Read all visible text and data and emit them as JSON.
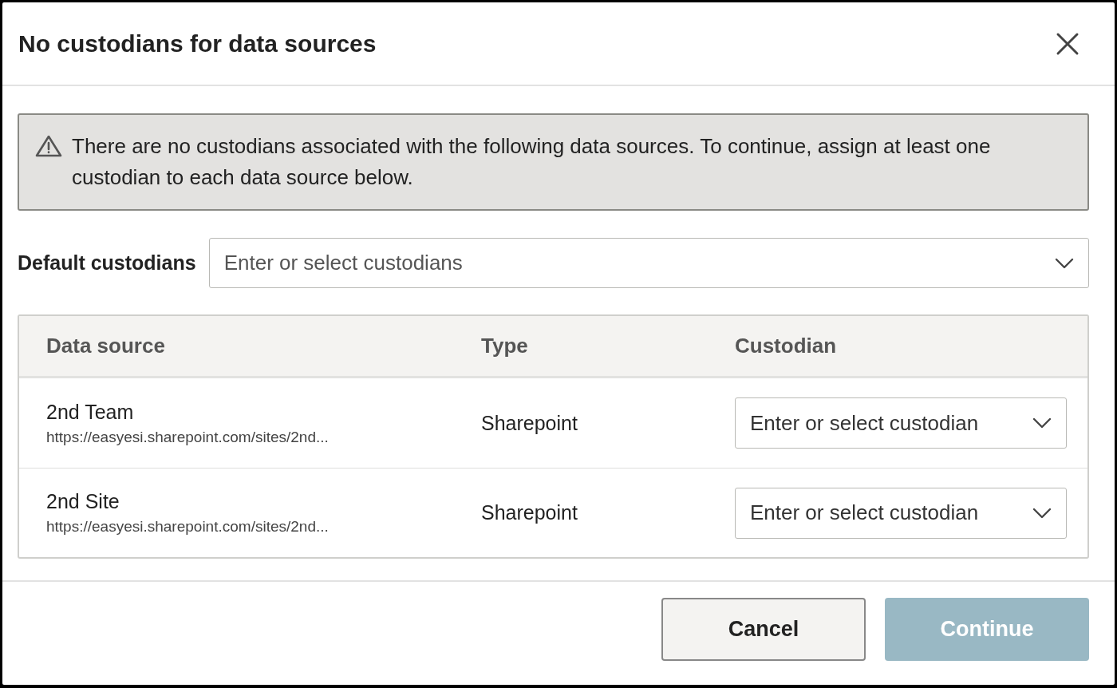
{
  "dialog": {
    "title": "No custodians for data sources"
  },
  "warning": {
    "text": "There are no custodians associated with the following data sources. To continue, assign at least one custodian to each data source below."
  },
  "default_custodians": {
    "label": "Default custodians",
    "placeholder": "Enter or select custodians"
  },
  "table": {
    "columns": [
      "Data source",
      "Type",
      "Custodian"
    ],
    "rows": [
      {
        "name": "2nd Team",
        "url": "https://easyesi.sharepoint.com/sites/2nd...",
        "type": "Sharepoint",
        "custodian_placeholder": "Enter or select custodian"
      },
      {
        "name": "2nd Site",
        "url": "https://easyesi.sharepoint.com/sites/2nd...",
        "type": "Sharepoint",
        "custodian_placeholder": "Enter or select custodian"
      }
    ]
  },
  "buttons": [
    {
      "label": "Cancel",
      "kind": "secondary",
      "disabled": false
    },
    {
      "label": "Continue",
      "kind": "primary",
      "disabled": true
    }
  ]
}
